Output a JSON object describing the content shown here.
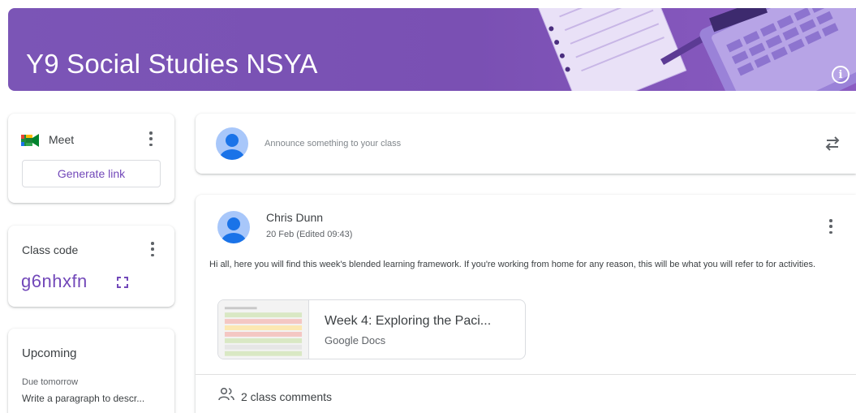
{
  "banner": {
    "title": "Y9 Social Studies NSYA",
    "color": "#7b55b6"
  },
  "meet": {
    "label": "Meet",
    "button_label": "Generate link",
    "icon": "google-meet-icon"
  },
  "class_code": {
    "label": "Class code",
    "value": "g6nhxfn"
  },
  "upcoming": {
    "title": "Upcoming",
    "due_label": "Due tomorrow",
    "item": "Write a paragraph to descr..."
  },
  "announce": {
    "placeholder": "Announce something to your class"
  },
  "post": {
    "author": "Chris Dunn",
    "date": "20 Feb (Edited 09:43)",
    "body": "Hi all, here you will find this week's blended learning framework. If you're working from home for any reason, this will be what you will refer to for activities.",
    "attachment": {
      "title": "Week 4: Exploring the Paci...",
      "type": "Google Docs"
    },
    "comments": "2 class comments"
  },
  "colors": {
    "accent": "#7248b9",
    "avatar_bg": "#a8c7fa",
    "avatar_fg": "#1a73e8"
  }
}
